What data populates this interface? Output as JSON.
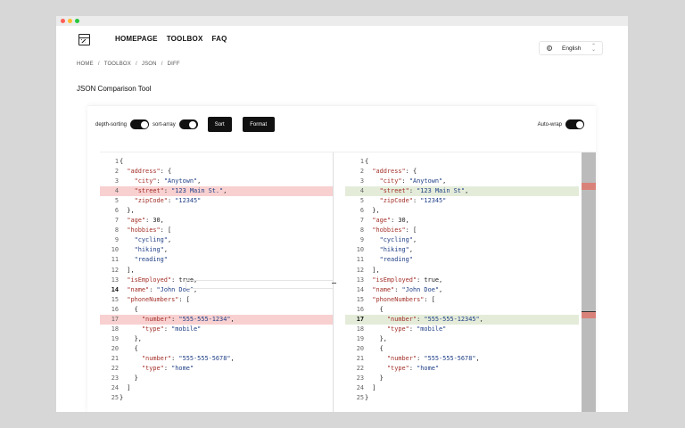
{
  "nav": {
    "items": [
      "HOMEPAGE",
      "TOOLBOX",
      "FAQ"
    ]
  },
  "language": {
    "selected": "English"
  },
  "breadcrumb": [
    "HOME",
    "TOOLBOX",
    "JSON",
    "DIFF"
  ],
  "page_title": "JSON Comparison Tool",
  "toolbar": {
    "depth_sorting_label": "depth-sorting",
    "sort_array_label": "sort-array",
    "sort_label": "Sort",
    "format_label": "Format",
    "auto_wrap_label": "Auto-wrap",
    "depth_sorting_on": true,
    "sort_array_on": true,
    "auto_wrap_on": true
  },
  "colors": {
    "removed": "#f8d0d0",
    "added": "#e4ecd9",
    "key": "#a3312a",
    "string": "#1f3f86"
  },
  "left_lines": [
    {
      "n": "1",
      "t": "{"
    },
    {
      "n": "2",
      "t": "  \"address\": {"
    },
    {
      "n": "3",
      "t": "    \"city\": \"Anytown\","
    },
    {
      "n": "4",
      "t": "    \"street\": \"123 Main St.\",",
      "hl": "del"
    },
    {
      "n": "5",
      "t": "    \"zipCode\": \"12345\""
    },
    {
      "n": "6",
      "t": "  },"
    },
    {
      "n": "7",
      "t": "  \"age\": 30,"
    },
    {
      "n": "8",
      "t": "  \"hobbies\": ["
    },
    {
      "n": "9",
      "t": "    \"cycling\","
    },
    {
      "n": "10",
      "t": "    \"hiking\","
    },
    {
      "n": "11",
      "t": "    \"reading\""
    },
    {
      "n": "12",
      "t": "  ],"
    },
    {
      "n": "13",
      "t": "  \"isEmployed\": true,"
    },
    {
      "n": "14",
      "t": "  \"name\": \"John Doe\",",
      "active": true
    },
    {
      "n": "15",
      "t": "  \"phoneNumbers\": ["
    },
    {
      "n": "16",
      "t": "    {"
    },
    {
      "n": "17",
      "t": "      \"number\": \"555-555-1234\",",
      "hl": "del"
    },
    {
      "n": "18",
      "t": "      \"type\": \"mobile\""
    },
    {
      "n": "19",
      "t": "    },"
    },
    {
      "n": "20",
      "t": "    {"
    },
    {
      "n": "21",
      "t": "      \"number\": \"555-555-5678\","
    },
    {
      "n": "22",
      "t": "      \"type\": \"home\""
    },
    {
      "n": "23",
      "t": "    }"
    },
    {
      "n": "24",
      "t": "  ]"
    },
    {
      "n": "25",
      "t": "}"
    }
  ],
  "right_lines": [
    {
      "n": "1",
      "t": "{"
    },
    {
      "n": "2",
      "t": "  \"address\": {"
    },
    {
      "n": "3",
      "t": "    \"city\": \"Anytown\","
    },
    {
      "n": "4",
      "t": "    \"street\": \"123 Main St\",",
      "hl": "add"
    },
    {
      "n": "5",
      "t": "    \"zipCode\": \"12345\""
    },
    {
      "n": "6",
      "t": "  },"
    },
    {
      "n": "7",
      "t": "  \"age\": 30,"
    },
    {
      "n": "8",
      "t": "  \"hobbies\": ["
    },
    {
      "n": "9",
      "t": "    \"cycling\","
    },
    {
      "n": "10",
      "t": "    \"hiking\","
    },
    {
      "n": "11",
      "t": "    \"reading\""
    },
    {
      "n": "12",
      "t": "  ],"
    },
    {
      "n": "13",
      "t": "  \"isEmployed\": true,"
    },
    {
      "n": "14",
      "t": "  \"name\": \"John Doe\","
    },
    {
      "n": "15",
      "t": "  \"phoneNumbers\": ["
    },
    {
      "n": "16",
      "t": "    {"
    },
    {
      "n": "17",
      "t": "      \"number\": \"555-555-12345\",",
      "hl": "add",
      "active": true
    },
    {
      "n": "18",
      "t": "      \"type\": \"mobile\""
    },
    {
      "n": "19",
      "t": "    },"
    },
    {
      "n": "20",
      "t": "    {"
    },
    {
      "n": "21",
      "t": "      \"number\": \"555-555-5678\","
    },
    {
      "n": "22",
      "t": "      \"type\": \"home\""
    },
    {
      "n": "23",
      "t": "    }"
    },
    {
      "n": "24",
      "t": "  ]"
    },
    {
      "n": "25",
      "t": "}"
    }
  ]
}
